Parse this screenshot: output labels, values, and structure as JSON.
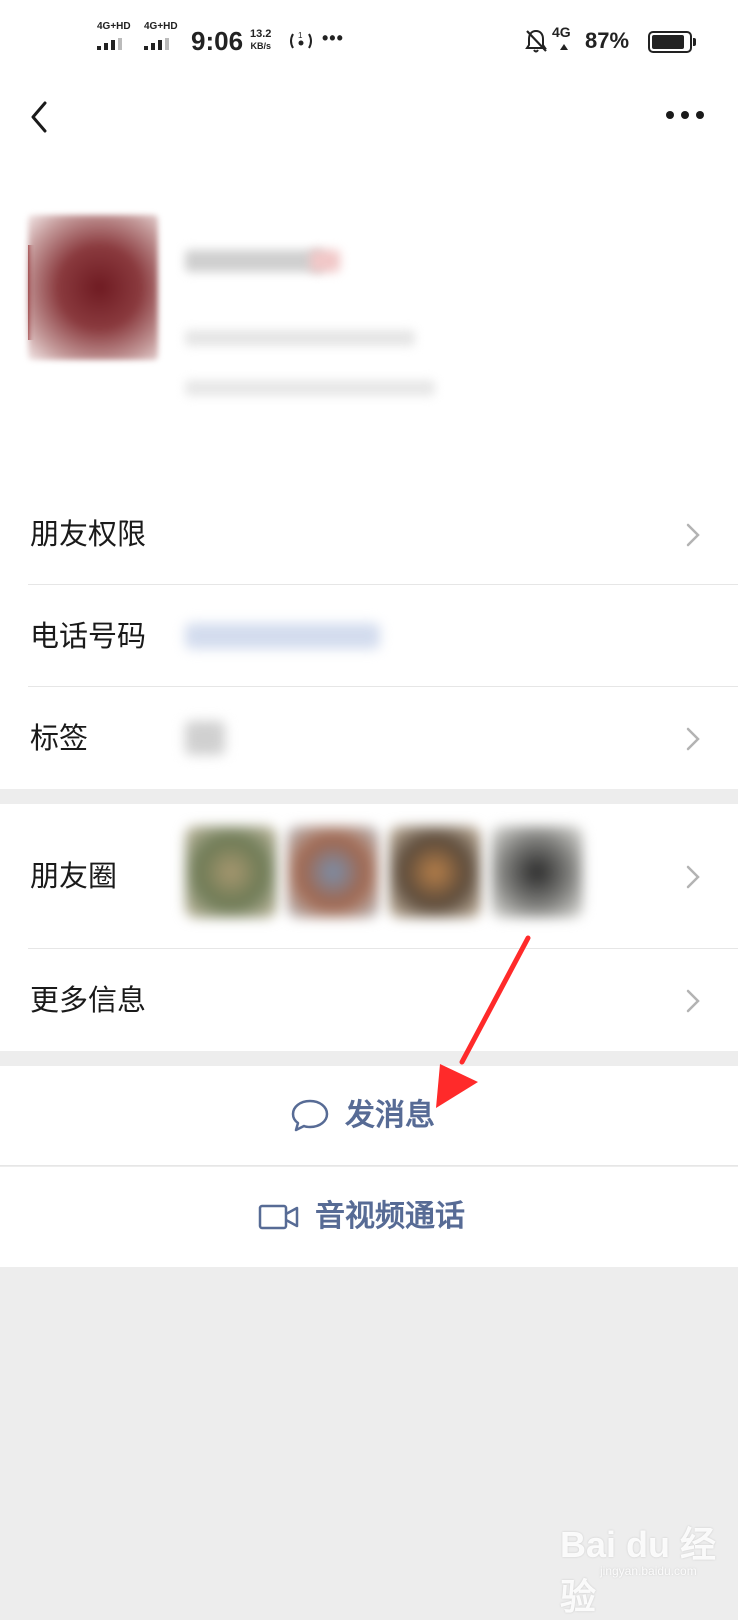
{
  "status_bar": {
    "network_1": "4G+HD",
    "network_2": "4G+HD",
    "time": "9:06",
    "speed_value": "13.2",
    "speed_unit": "KB/s",
    "more_indicator": "•••",
    "data_network": "4G",
    "battery_percent": "87%"
  },
  "header": {
    "back_icon": "chevron-left-icon",
    "more_icon": "more-horizontal-icon"
  },
  "rows": {
    "friend_permissions": "朋友权限",
    "phone_number": "电话号码",
    "tags": "标签",
    "moments": "朋友圈",
    "more_info": "更多信息"
  },
  "actions": {
    "send_message": "发消息",
    "video_call": "音视频通话"
  },
  "colors": {
    "accent": "#576b95",
    "background": "#ededed",
    "annotation_arrow": "#ff2a2a"
  },
  "watermark": {
    "brand": "Bai du 经验",
    "url": "jingyan.baidu.com"
  }
}
